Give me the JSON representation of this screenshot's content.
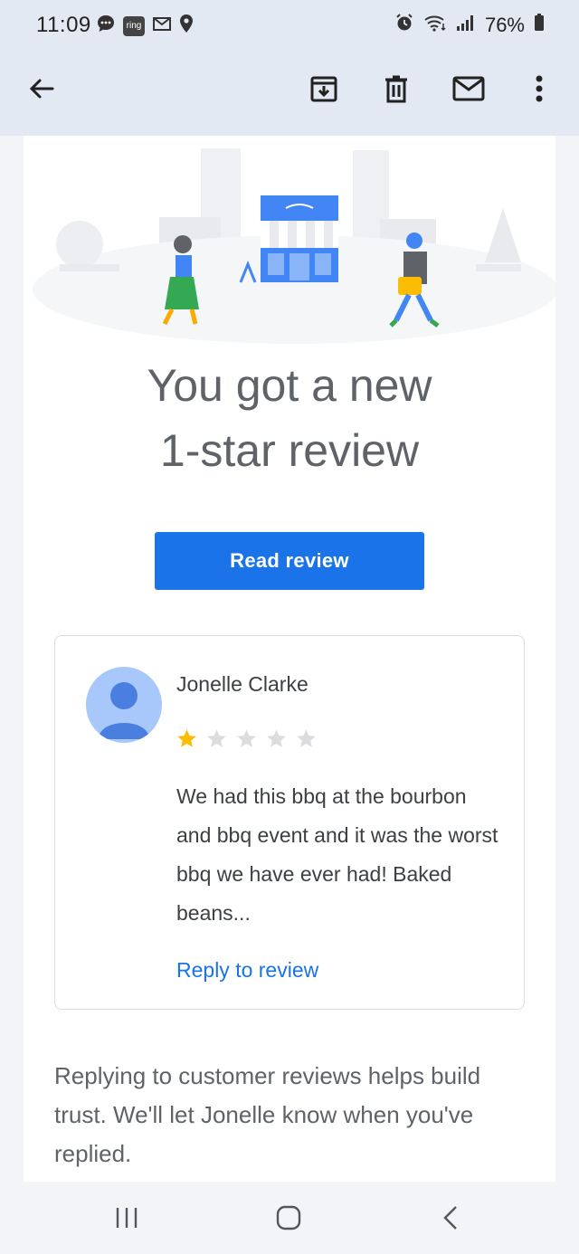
{
  "status_bar": {
    "time": "11:09",
    "battery": "76%",
    "left_icons": [
      "chat-bubble-icon",
      "ring-app-icon",
      "gmail-icon",
      "location-icon"
    ],
    "ring_label": "ring",
    "right_icons": [
      "alarm-icon",
      "wifi-icon",
      "signal-icon",
      "battery-icon"
    ]
  },
  "toolbar": {
    "back": "back-arrow-icon",
    "actions": [
      "archive-icon",
      "delete-icon",
      "mark-unread-icon",
      "more-vert-icon"
    ]
  },
  "email": {
    "headline_line1": "You got a new",
    "headline_line2": "1-star review",
    "cta_label": "Read review",
    "review": {
      "reviewer_name": "Jonelle Clarke",
      "rating": 1,
      "rating_max": 5,
      "text": "We had this bbq at the bourbon and bbq event and it was the worst bbq we have ever had! Baked beans...",
      "reply_label": "Reply to review"
    },
    "footer_text": "Replying to customer reviews helps build trust. We'll let Jonelle know when you've replied."
  },
  "colors": {
    "accent": "#1a73e8",
    "star_filled": "#fbbc04",
    "star_empty": "#dadce0",
    "toolbar_bg": "#e2e9f2"
  },
  "nav_bar": {
    "buttons": [
      "recent-apps-icon",
      "home-icon",
      "back-icon"
    ]
  }
}
